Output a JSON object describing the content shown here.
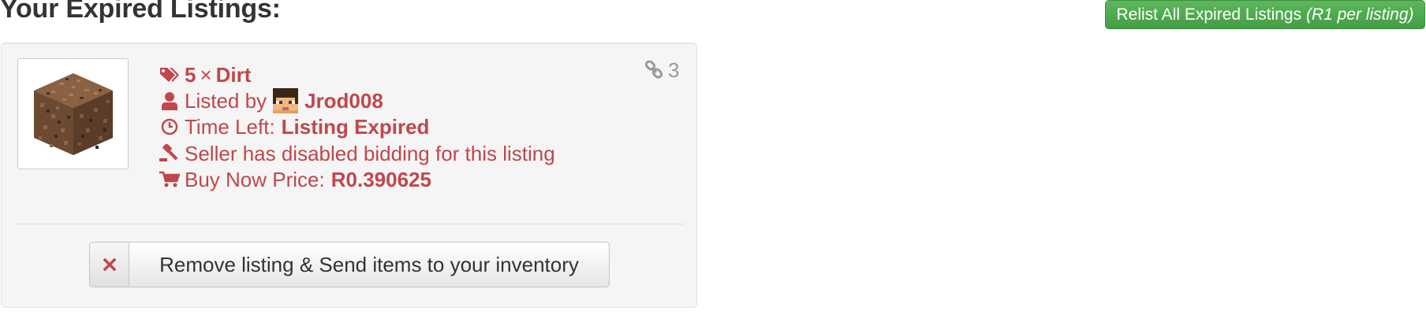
{
  "header": {
    "title": "Your Expired Listings:",
    "relist_label": "Relist All Expired Listings",
    "relist_note": "(R1 per listing)"
  },
  "listing": {
    "item_icon": "dirt-block",
    "quantity": "5",
    "times_sign": "×",
    "item_name": "Dirt",
    "link_count": "3",
    "listed_by_label": "Listed by",
    "seller_name": "Jrod008",
    "time_left_label": "Time Left:",
    "time_left_value": "Listing Expired",
    "bidding_text": "Seller has disabled bidding for this listing",
    "buy_now_label": "Buy Now Price:",
    "buy_now_value": "R0.390625",
    "remove_label": "Remove listing & Send items to your inventory"
  },
  "colors": {
    "accent_red": "#c0474c",
    "relist_green": "#5cb85c",
    "muted_gray": "#9a9a9a"
  },
  "icons": {
    "tags": "tags-icon",
    "user": "user-icon",
    "clock": "clock-icon",
    "gavel": "gavel-icon",
    "cart": "cart-icon",
    "link": "link-icon",
    "remove": "close-icon"
  }
}
